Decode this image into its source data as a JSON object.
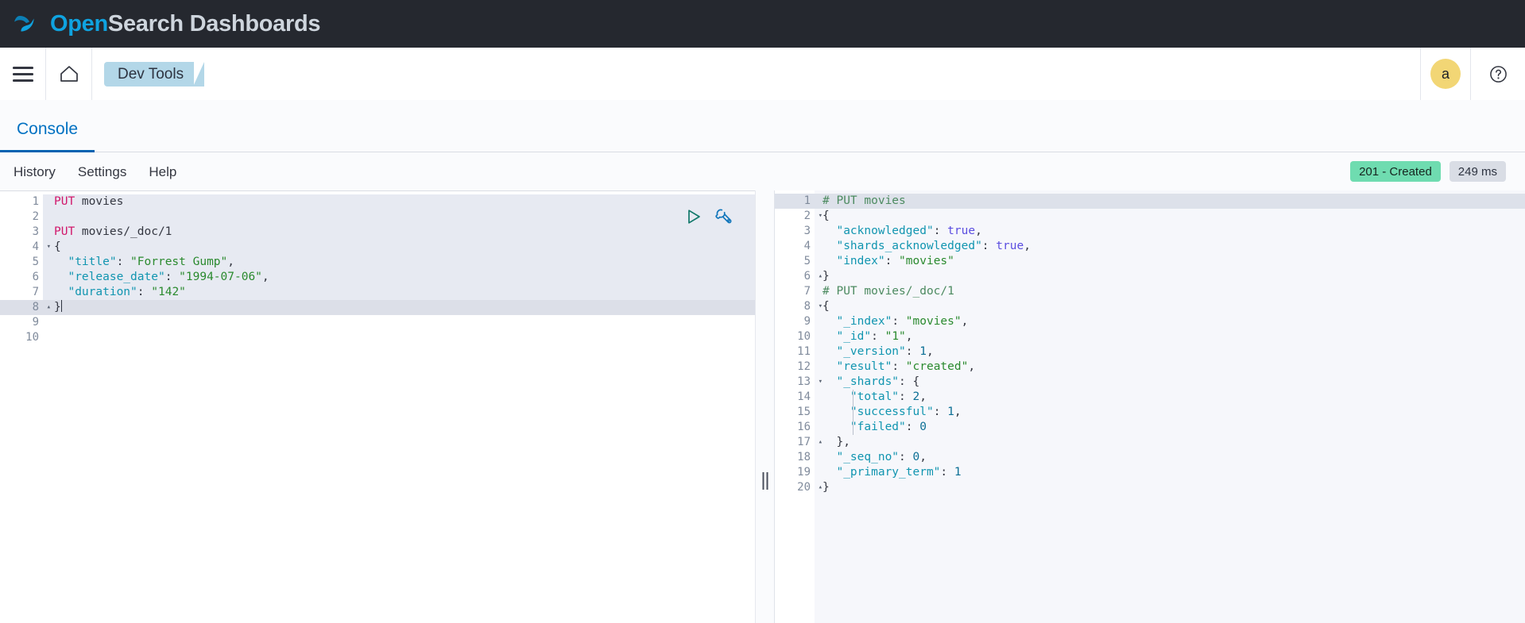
{
  "header": {
    "logo": {
      "icon": "opensearch-swoosh-icon",
      "part1": "Open",
      "part2": "Search",
      "part3": " Dashboards"
    }
  },
  "nav": {
    "menu_icon": "hamburger-menu-icon",
    "home_icon": "home-icon",
    "breadcrumb": "Dev Tools",
    "avatar_initial": "a",
    "help_icon": "help-circle-icon"
  },
  "tabs": [
    {
      "label": "Console",
      "active": true
    }
  ],
  "toolbar": {
    "links": [
      "History",
      "Settings",
      "Help"
    ],
    "status_badge": "201 - Created",
    "time_badge": "249 ms",
    "status_color": "#6fdcb0",
    "time_color": "#d9dde5"
  },
  "editor": {
    "play_icon": "play-request-icon",
    "wrench_icon": "wrench-settings-icon",
    "cursor_line": 8,
    "lines": [
      {
        "n": "1",
        "fold": "",
        "tokens": [
          {
            "t": "PUT ",
            "c": "k-method"
          },
          {
            "t": "movies",
            "c": "k-url"
          }
        ]
      },
      {
        "n": "2",
        "fold": "",
        "tokens": []
      },
      {
        "n": "3",
        "fold": "",
        "tokens": [
          {
            "t": "PUT ",
            "c": "k-method"
          },
          {
            "t": "movies/_doc/1",
            "c": "k-url"
          }
        ]
      },
      {
        "n": "4",
        "fold": "▾",
        "tokens": [
          {
            "t": "{",
            "c": "k-punc"
          }
        ]
      },
      {
        "n": "5",
        "fold": "",
        "tokens": [
          {
            "t": "  ",
            "c": "k-punc"
          },
          {
            "t": "\"title\"",
            "c": "k-key"
          },
          {
            "t": ": ",
            "c": "k-punc"
          },
          {
            "t": "\"Forrest Gump\"",
            "c": "k-str"
          },
          {
            "t": ",",
            "c": "k-punc"
          }
        ]
      },
      {
        "n": "6",
        "fold": "",
        "tokens": [
          {
            "t": "  ",
            "c": "k-punc"
          },
          {
            "t": "\"release_date\"",
            "c": "k-key"
          },
          {
            "t": ": ",
            "c": "k-punc"
          },
          {
            "t": "\"1994-07-06\"",
            "c": "k-str"
          },
          {
            "t": ",",
            "c": "k-punc"
          }
        ]
      },
      {
        "n": "7",
        "fold": "",
        "tokens": [
          {
            "t": "  ",
            "c": "k-punc"
          },
          {
            "t": "\"duration\"",
            "c": "k-key"
          },
          {
            "t": ": ",
            "c": "k-punc"
          },
          {
            "t": "\"142\"",
            "c": "k-str"
          }
        ]
      },
      {
        "n": "8",
        "fold": "▴",
        "tokens": [
          {
            "t": "}",
            "c": "k-punc"
          }
        ]
      },
      {
        "n": "9",
        "fold": "",
        "tokens": []
      },
      {
        "n": "10",
        "fold": "",
        "tokens": []
      }
    ]
  },
  "response": {
    "highlight_line": 1,
    "lines": [
      {
        "n": "1",
        "fold": "",
        "tokens": [
          {
            "t": "# PUT movies",
            "c": "k-comment"
          }
        ]
      },
      {
        "n": "2",
        "fold": "▾",
        "tokens": [
          {
            "t": "{",
            "c": "k-punc"
          }
        ]
      },
      {
        "n": "3",
        "fold": "",
        "tokens": [
          {
            "t": "  ",
            "c": "k-punc"
          },
          {
            "t": "\"acknowledged\"",
            "c": "k-key"
          },
          {
            "t": ": ",
            "c": "k-punc"
          },
          {
            "t": "true",
            "c": "k-bool"
          },
          {
            "t": ",",
            "c": "k-punc"
          }
        ]
      },
      {
        "n": "4",
        "fold": "",
        "tokens": [
          {
            "t": "  ",
            "c": "k-punc"
          },
          {
            "t": "\"shards_acknowledged\"",
            "c": "k-key"
          },
          {
            "t": ": ",
            "c": "k-punc"
          },
          {
            "t": "true",
            "c": "k-bool"
          },
          {
            "t": ",",
            "c": "k-punc"
          }
        ]
      },
      {
        "n": "5",
        "fold": "",
        "tokens": [
          {
            "t": "  ",
            "c": "k-punc"
          },
          {
            "t": "\"index\"",
            "c": "k-key"
          },
          {
            "t": ": ",
            "c": "k-punc"
          },
          {
            "t": "\"movies\"",
            "c": "k-str"
          }
        ]
      },
      {
        "n": "6",
        "fold": "▴",
        "tokens": [
          {
            "t": "}",
            "c": "k-punc"
          }
        ]
      },
      {
        "n": "7",
        "fold": "",
        "tokens": [
          {
            "t": "# PUT movies/_doc/1",
            "c": "k-comment"
          }
        ]
      },
      {
        "n": "8",
        "fold": "▾",
        "tokens": [
          {
            "t": "{",
            "c": "k-punc"
          }
        ]
      },
      {
        "n": "9",
        "fold": "",
        "tokens": [
          {
            "t": "  ",
            "c": "k-punc"
          },
          {
            "t": "\"_index\"",
            "c": "k-key"
          },
          {
            "t": ": ",
            "c": "k-punc"
          },
          {
            "t": "\"movies\"",
            "c": "k-str"
          },
          {
            "t": ",",
            "c": "k-punc"
          }
        ]
      },
      {
        "n": "10",
        "fold": "",
        "tokens": [
          {
            "t": "  ",
            "c": "k-punc"
          },
          {
            "t": "\"_id\"",
            "c": "k-key"
          },
          {
            "t": ": ",
            "c": "k-punc"
          },
          {
            "t": "\"1\"",
            "c": "k-str"
          },
          {
            "t": ",",
            "c": "k-punc"
          }
        ]
      },
      {
        "n": "11",
        "fold": "",
        "tokens": [
          {
            "t": "  ",
            "c": "k-punc"
          },
          {
            "t": "\"_version\"",
            "c": "k-key"
          },
          {
            "t": ": ",
            "c": "k-punc"
          },
          {
            "t": "1",
            "c": "k-num"
          },
          {
            "t": ",",
            "c": "k-punc"
          }
        ]
      },
      {
        "n": "12",
        "fold": "",
        "tokens": [
          {
            "t": "  ",
            "c": "k-punc"
          },
          {
            "t": "\"result\"",
            "c": "k-key"
          },
          {
            "t": ": ",
            "c": "k-punc"
          },
          {
            "t": "\"created\"",
            "c": "k-str"
          },
          {
            "t": ",",
            "c": "k-punc"
          }
        ]
      },
      {
        "n": "13",
        "fold": "▾",
        "tokens": [
          {
            "t": "  ",
            "c": "k-punc"
          },
          {
            "t": "\"_shards\"",
            "c": "k-key"
          },
          {
            "t": ": ",
            "c": "k-punc"
          },
          {
            "t": "{",
            "c": "k-punc"
          }
        ]
      },
      {
        "n": "14",
        "fold": "",
        "tokens": [
          {
            "t": "    ",
            "c": "k-punc"
          },
          {
            "t": "\"total\"",
            "c": "k-key"
          },
          {
            "t": ": ",
            "c": "k-punc"
          },
          {
            "t": "2",
            "c": "k-num"
          },
          {
            "t": ",",
            "c": "k-punc"
          }
        ]
      },
      {
        "n": "15",
        "fold": "",
        "tokens": [
          {
            "t": "    ",
            "c": "k-punc"
          },
          {
            "t": "\"successful\"",
            "c": "k-key"
          },
          {
            "t": ": ",
            "c": "k-punc"
          },
          {
            "t": "1",
            "c": "k-num"
          },
          {
            "t": ",",
            "c": "k-punc"
          }
        ]
      },
      {
        "n": "16",
        "fold": "",
        "tokens": [
          {
            "t": "    ",
            "c": "k-punc"
          },
          {
            "t": "\"failed\"",
            "c": "k-key"
          },
          {
            "t": ": ",
            "c": "k-punc"
          },
          {
            "t": "0",
            "c": "k-num"
          }
        ]
      },
      {
        "n": "17",
        "fold": "▴",
        "tokens": [
          {
            "t": "  ",
            "c": "k-punc"
          },
          {
            "t": "},",
            "c": "k-punc"
          }
        ]
      },
      {
        "n": "18",
        "fold": "",
        "tokens": [
          {
            "t": "  ",
            "c": "k-punc"
          },
          {
            "t": "\"_seq_no\"",
            "c": "k-key"
          },
          {
            "t": ": ",
            "c": "k-punc"
          },
          {
            "t": "0",
            "c": "k-num"
          },
          {
            "t": ",",
            "c": "k-punc"
          }
        ]
      },
      {
        "n": "19",
        "fold": "",
        "tokens": [
          {
            "t": "  ",
            "c": "k-punc"
          },
          {
            "t": "\"_primary_term\"",
            "c": "k-key"
          },
          {
            "t": ": ",
            "c": "k-punc"
          },
          {
            "t": "1",
            "c": "k-num"
          }
        ]
      },
      {
        "n": "20",
        "fold": "▴",
        "tokens": [
          {
            "t": "}",
            "c": "k-punc"
          }
        ]
      }
    ]
  },
  "splitter": {
    "icon": "vertical-drag-handle-icon"
  }
}
